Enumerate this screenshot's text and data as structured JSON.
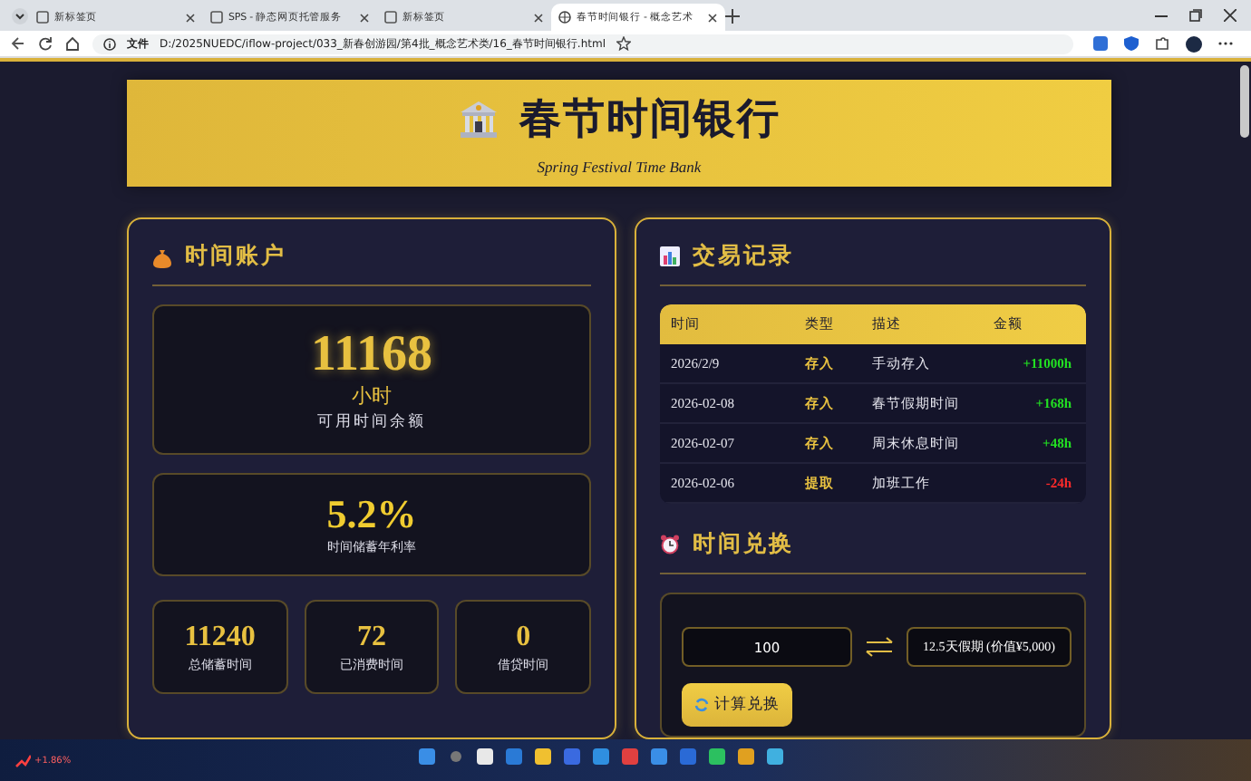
{
  "browser": {
    "tabs": [
      {
        "title": "新标签页",
        "selected": false
      },
      {
        "title": "SPS - 静态网页托管服务",
        "selected": false
      },
      {
        "title": "新标签页",
        "selected": false
      },
      {
        "title": "春节时间银行 - 概念艺术",
        "selected": true
      }
    ],
    "address": {
      "scheme_label": "文件",
      "url": "D:/2025NUEDC/iflow-project/033_新春创游园/第4批_概念艺术类/16_春节时间银行.html"
    }
  },
  "header": {
    "title": "春节时间银行",
    "subtitle": "Spring Festival Time Bank"
  },
  "account": {
    "title": "时间账户",
    "balance": {
      "value": "11168",
      "unit": "小时",
      "label": "可用时间余额"
    },
    "rate": {
      "value": "5.2%",
      "label": "时间储蓄年利率"
    },
    "stats": [
      {
        "value": "11240",
        "label": "总储蓄时间"
      },
      {
        "value": "72",
        "label": "已消费时间"
      },
      {
        "value": "0",
        "label": "借贷时间"
      }
    ]
  },
  "transactions": {
    "title": "交易记录",
    "columns": [
      "时间",
      "类型",
      "描述",
      "金额"
    ],
    "rows": [
      {
        "date": "2026/2/9",
        "type": "存入",
        "description": "手动存入",
        "amount": "+11000h",
        "kind": "deposit"
      },
      {
        "date": "2026-02-08",
        "type": "存入",
        "description": "春节假期时间",
        "amount": "+168h",
        "kind": "deposit"
      },
      {
        "date": "2026-02-07",
        "type": "存入",
        "description": "周末休息时间",
        "amount": "+48h",
        "kind": "deposit"
      },
      {
        "date": "2026-02-06",
        "type": "提取",
        "description": "加班工作",
        "amount": "-24h",
        "kind": "withdraw"
      }
    ]
  },
  "exchange": {
    "title": "时间兑换",
    "input_value": "100",
    "result": "12.5天假期 (价值¥5,000)",
    "button": "计算兑换"
  },
  "taskbar": {
    "stock_change": "+1.86%"
  }
}
